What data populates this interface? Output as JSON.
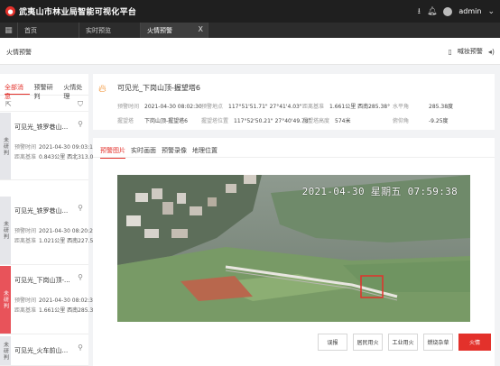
{
  "app": {
    "title": "武夷山市林业局智能可视化平台",
    "user": "admin"
  },
  "tabs": [
    {
      "label": "首页"
    },
    {
      "label": "实时预览"
    },
    {
      "label": "火情预警",
      "close": "X"
    }
  ],
  "page": {
    "title": "火情预警",
    "sound": "喊妆预警"
  },
  "left": {
    "tabs": [
      "全部消息",
      "预警研判",
      "火情处理"
    ],
    "alarms": [
      {
        "status": "未研判",
        "loc": "可见光_铁罗巷山...",
        "time_label": "预警时间",
        "time": "2021-04-30 09:03:12",
        "dist_label": "距离基准",
        "dist": "0.843公里 西北313.04°"
      },
      {
        "status": "未研判",
        "loc": "可见光_铁罗巷山...",
        "time_label": "预警时间",
        "time": "2021-04-30 08:20:20",
        "dist_label": "距离基准",
        "dist": "1.021公里 西南227.53°"
      },
      {
        "status": "未研判",
        "loc": "可见光_下岗山顶-...",
        "time_label": "预警时间",
        "time": "2021-04-30 08:02:30",
        "dist_label": "距离基准",
        "dist": "1.661公里 西南285.38°"
      },
      {
        "status": "未研判",
        "loc": "可见光_火车前山...",
        "time_label": "预警时间",
        "time": "",
        "dist_label": "",
        "dist": ""
      }
    ]
  },
  "info": {
    "title": "可见光_下岗山顶-握望塔6",
    "fields": [
      {
        "label": "预警时间",
        "value": "2021-04-30 08:02:30"
      },
      {
        "label": "预警地点",
        "value": "117°51'51.71\" 27°41'4.03\""
      },
      {
        "label": "距离基准",
        "value": "1.661公里 西南285.38°"
      },
      {
        "label": "水平角",
        "value": "285.38度"
      },
      {
        "label": "握望塔",
        "value": "下岗山顶-握望塔6"
      },
      {
        "label": "握望塔位置",
        "value": "117°52'50.21\" 27°40'49.78\""
      },
      {
        "label": "握望塔高度",
        "value": "574米"
      },
      {
        "label": "俯仰角",
        "value": "-9.25度"
      }
    ]
  },
  "detail": {
    "tabs": [
      "预警图片",
      "实时画面",
      "预警录像",
      "地理位置"
    ],
    "timestamp": "2021-04-30 星期五 07:59:38"
  },
  "actions": [
    "误报",
    "居民用火",
    "工业用火",
    "燃烧杂草",
    "火情"
  ],
  "colors": {
    "accent": "#e3312b",
    "topbar": "#1f1f1f"
  }
}
